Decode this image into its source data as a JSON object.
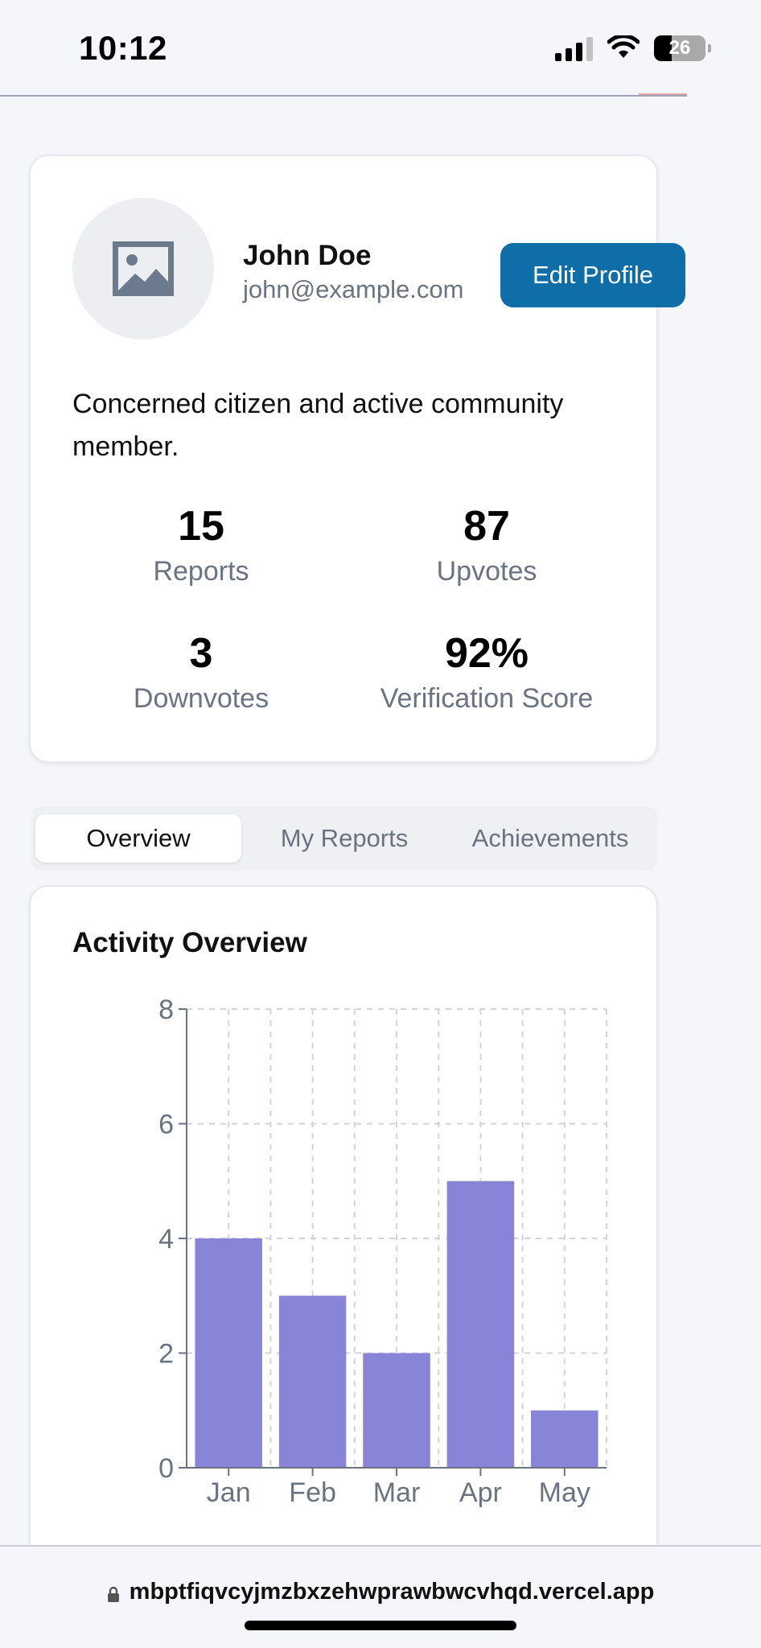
{
  "status_bar": {
    "time": "10:12",
    "battery": "26"
  },
  "profile": {
    "name": "John Doe",
    "email": "john@example.com",
    "edit_button": "Edit Profile",
    "bio": "Concerned citizen and active community member.",
    "stats": [
      {
        "value": "15",
        "label": "Reports"
      },
      {
        "value": "87",
        "label": "Upvotes"
      },
      {
        "value": "3",
        "label": "Downvotes"
      },
      {
        "value": "92%",
        "label": "Verification Score"
      }
    ]
  },
  "tabs": [
    {
      "label": "Overview",
      "active": true
    },
    {
      "label": "My Reports",
      "active": false
    },
    {
      "label": "Achievements",
      "active": false
    }
  ],
  "activity": {
    "title": "Activity Overview"
  },
  "chart_data": {
    "type": "bar",
    "title": "Activity Overview",
    "categories": [
      "Jan",
      "Feb",
      "Mar",
      "Apr",
      "May"
    ],
    "values": [
      4,
      3,
      2,
      5,
      1
    ],
    "ylim": [
      0,
      8
    ],
    "yticks": [
      0,
      2,
      4,
      6,
      8
    ],
    "grid": true,
    "bar_color": "#8884d8"
  },
  "url_bar": {
    "url": "mbptfiqvcyjmzbxzehwprawbwcvhqd.vercel.app"
  },
  "colors": {
    "accent": "#0f6ea8",
    "bar": "#8884d8",
    "background": "#f4f6fa"
  }
}
